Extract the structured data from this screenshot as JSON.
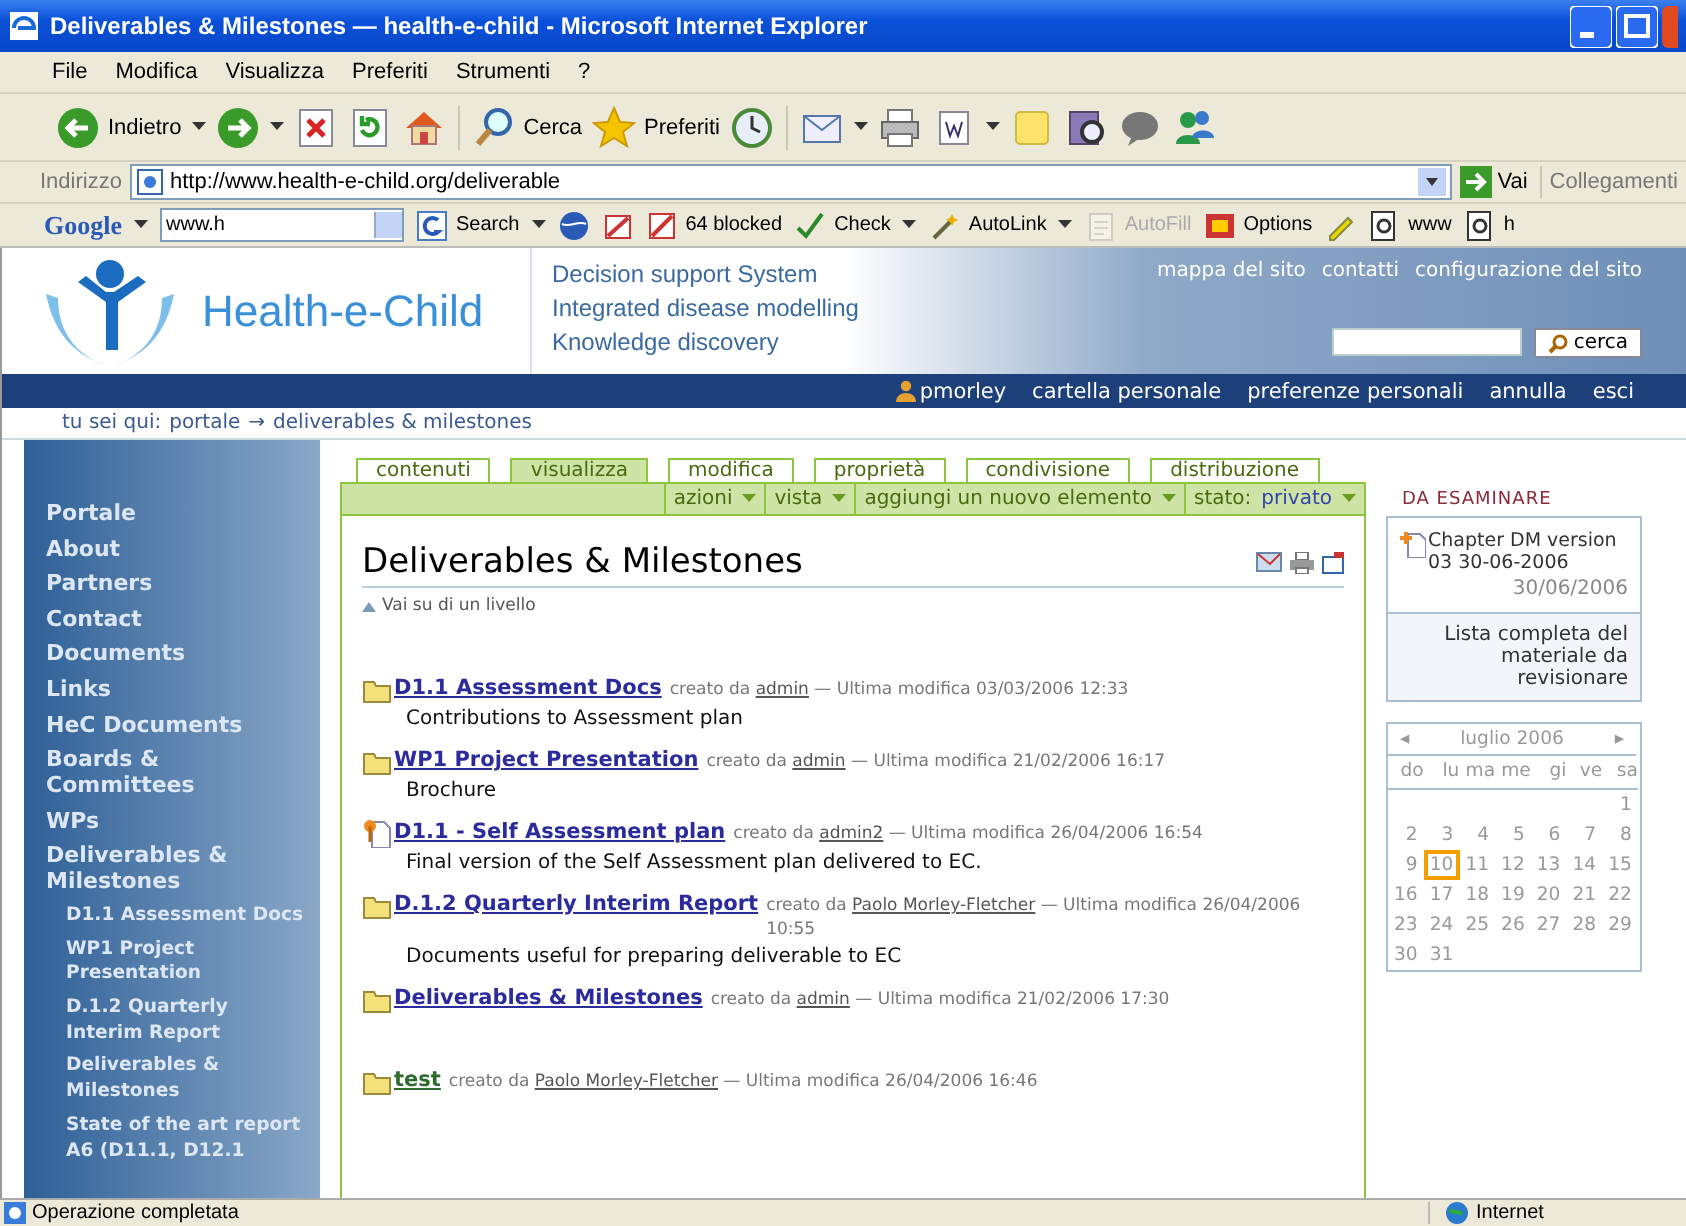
{
  "window": {
    "title": "Deliverables & Milestones — health-e-child - Microsoft Internet Explorer"
  },
  "menu": [
    {
      "label": "File"
    },
    {
      "label": "Modifica"
    },
    {
      "label": "Visualizza"
    },
    {
      "label": "Preferiti"
    },
    {
      "label": "Strumenti"
    },
    {
      "label": "?"
    }
  ],
  "toolbar": {
    "groups": [
      [
        {
          "kind": "back",
          "label": "Indietro",
          "dropdown": true
        },
        {
          "kind": "forward",
          "dropdown": true
        },
        {
          "kind": "stop",
          "dropdown": false
        },
        {
          "kind": "refresh",
          "dropdown": false
        },
        {
          "kind": "home",
          "dropdown": false
        }
      ],
      [
        {
          "kind": "search",
          "label": "Cerca",
          "dropdown": false
        },
        {
          "kind": "favorites",
          "label": "Preferiti",
          "dropdown": false
        },
        {
          "kind": "history",
          "dropdown": false
        }
      ],
      [
        {
          "kind": "mail",
          "dropdown": true
        },
        {
          "kind": "print",
          "dropdown": false
        },
        {
          "kind": "word",
          "dropdown": true
        },
        {
          "kind": "note",
          "dropdown": false
        },
        {
          "kind": "research",
          "dropdown": false
        },
        {
          "kind": "messenger",
          "dropdown": false
        },
        {
          "kind": "people",
          "dropdown": false
        }
      ]
    ]
  },
  "address": {
    "label": "Indirizzo",
    "value": "http://www.health-e-child.org/deliverable",
    "go": "Vai",
    "links": "Collegamenti"
  },
  "google_bar": {
    "logo": "Google",
    "value": "www.h",
    "items": [
      {
        "kind": "search",
        "label": "Search",
        "dropdown": true,
        "disabled": false
      },
      {
        "kind": "globe",
        "dropdown": false,
        "disabled": false
      },
      {
        "kind": "popup",
        "dropdown": false,
        "disabled": false
      },
      {
        "kind": "blocked",
        "label": "64 blocked",
        "dropdown": false,
        "disabled": false
      },
      {
        "kind": "check",
        "label": "Check",
        "dropdown": true,
        "disabled": false
      },
      {
        "kind": "autolink",
        "label": "AutoLink",
        "dropdown": true,
        "disabled": false
      },
      {
        "kind": "autofill",
        "label": "AutoFill",
        "dropdown": false,
        "disabled": true
      },
      {
        "kind": "options",
        "label": "Options",
        "dropdown": false,
        "disabled": false
      },
      {
        "kind": "pencil",
        "dropdown": false,
        "disabled": false
      },
      {
        "kind": "page",
        "label": "www",
        "dropdown": false,
        "disabled": false
      },
      {
        "kind": "page",
        "label": "h",
        "dropdown": false,
        "disabled": false
      }
    ]
  },
  "site": {
    "logo": "Health-e-Child",
    "taglines": [
      "Decision support System",
      "Integrated disease modelling",
      "Knowledge discovery"
    ],
    "top_links": [
      "mappa del sito",
      "contatti",
      "configurazione del sito"
    ],
    "search_button": "cerca",
    "user": "pmorley",
    "user_links": [
      "cartella personale",
      "preferenze personali",
      "annulla",
      "esci"
    ],
    "breadcrumb": {
      "label": "tu sei qui:",
      "separator": "→",
      "items": [
        "portale",
        "deliverables & milestones"
      ]
    }
  },
  "sidebar": {
    "items": [
      {
        "label": "Portale"
      },
      {
        "label": "About"
      },
      {
        "label": "Partners"
      },
      {
        "label": "Contact"
      },
      {
        "label": "Documents"
      },
      {
        "label": "Links"
      },
      {
        "label": "HeC Documents"
      },
      {
        "label": "Boards & Committees"
      },
      {
        "label": "WPs"
      },
      {
        "label": "Deliverables & Milestones",
        "children": [
          {
            "label": "D1.1 Assessment Docs"
          },
          {
            "label": "WP1 Project Presentation"
          },
          {
            "label": "D.1.2 Quarterly Interim Report"
          },
          {
            "label": "Deliverables & Milestones"
          },
          {
            "label": "State of the art report A6 (D11.1, D12.1"
          }
        ]
      }
    ]
  },
  "content": {
    "tabs": [
      {
        "label": "contenuti",
        "selected": false
      },
      {
        "label": "visualizza",
        "selected": true
      },
      {
        "label": "modifica",
        "selected": false
      },
      {
        "label": "proprietà",
        "selected": false
      },
      {
        "label": "condivisione",
        "selected": false
      },
      {
        "label": "distribuzione",
        "selected": false
      }
    ],
    "actions": [
      {
        "label": "azioni"
      },
      {
        "label": "vista"
      },
      {
        "label": "aggiungi un nuovo elemento"
      },
      {
        "label": "stato:",
        "value": "privato"
      }
    ],
    "title": "Deliverables & Milestones",
    "up_link": "Vai su di un livello",
    "items": [
      {
        "kind": "folder",
        "title": "D1.1 Assessment Docs",
        "color": "#2b2b9c",
        "by": "creato da",
        "author": "admin",
        "modified": "— Ultima modifica 03/03/2006 12:33",
        "description": "Contributions to Assessment plan"
      },
      {
        "kind": "folder",
        "title": "WP1 Project Presentation",
        "color": "#2b2b9c",
        "by": "creato da",
        "author": "admin",
        "modified": "— Ultima modifica 21/02/2006 16:17",
        "description": "Brochure"
      },
      {
        "kind": "document",
        "title": "D1.1 - Self Assessment plan",
        "color": "#2b2b9c",
        "by": "creato da",
        "author": "admin2",
        "modified": "— Ultima modifica 26/04/2006 16:54",
        "description": "Final version of the Self Assessment plan delivered to EC."
      },
      {
        "kind": "folder",
        "title": "D.1.2 Quarterly Interim Report",
        "color": "#2b2b9c",
        "by": "creato da",
        "author": "Paolo Morley-Fletcher",
        "modified": "— Ultima modifica 26/04/2006 10:55",
        "description": "Documents useful for preparing deliverable to EC"
      },
      {
        "kind": "folder",
        "title": "Deliverables & Milestones",
        "color": "#2b2b9c",
        "by": "creato da",
        "author": "admin",
        "modified": "— Ultima modifica 21/02/2006 17:30"
      },
      {
        "kind": "folder",
        "title": "test",
        "color": "#2e6b2e",
        "by": "creato da",
        "author": "Paolo Morley-Fletcher",
        "modified": "— Ultima modifica 26/04/2006 16:46"
      }
    ]
  },
  "review": {
    "heading": "DA ESAMINARE",
    "item": {
      "title": "Chapter DM version 03 30-06-2006",
      "date": "30/06/2006"
    },
    "more": "Lista completa del materiale da revisionare"
  },
  "calendar": {
    "prev": "◂",
    "month": "luglio 2006",
    "next": "▸",
    "weekdays": [
      "do",
      "lu",
      "ma",
      "me",
      "gi",
      "ve",
      "sa"
    ],
    "weeks": [
      {
        "kind": "first",
        "days": [
          {
            "day": "1",
            "selected": false
          }
        ]
      },
      {
        "kind": "full",
        "days": [
          {
            "day": "2",
            "selected": false
          },
          {
            "day": "3",
            "selected": false
          },
          {
            "day": "4",
            "selected": false
          },
          {
            "day": "5",
            "selected": false
          },
          {
            "day": "6",
            "selected": false
          },
          {
            "day": "7",
            "selected": false
          },
          {
            "day": "8",
            "selected": false
          }
        ]
      },
      {
        "kind": "full",
        "days": [
          {
            "day": "9",
            "selected": false
          },
          {
            "day": "10",
            "selected": true
          },
          {
            "day": "11",
            "selected": false
          },
          {
            "day": "12",
            "selected": false
          },
          {
            "day": "13",
            "selected": false
          },
          {
            "day": "14",
            "selected": false
          },
          {
            "day": "15",
            "selected": false
          }
        ]
      },
      {
        "kind": "full",
        "days": [
          {
            "day": "16",
            "selected": false
          },
          {
            "day": "17",
            "selected": false
          },
          {
            "day": "18",
            "selected": false
          },
          {
            "day": "19",
            "selected": false
          },
          {
            "day": "20",
            "selected": false
          },
          {
            "day": "21",
            "selected": false
          },
          {
            "day": "22",
            "selected": false
          }
        ]
      },
      {
        "kind": "full",
        "days": [
          {
            "day": "23",
            "selected": false
          },
          {
            "day": "24",
            "selected": false
          },
          {
            "day": "25",
            "selected": false
          },
          {
            "day": "26",
            "selected": false
          },
          {
            "day": "27",
            "selected": false
          },
          {
            "day": "28",
            "selected": false
          },
          {
            "day": "29",
            "selected": false
          }
        ]
      },
      {
        "kind": "last",
        "days": [
          {
            "day": "30",
            "selected": false
          },
          {
            "day": "31",
            "selected": false
          }
        ]
      }
    ]
  },
  "status_bar": {
    "message": "Operazione completata",
    "zone": "Internet"
  }
}
